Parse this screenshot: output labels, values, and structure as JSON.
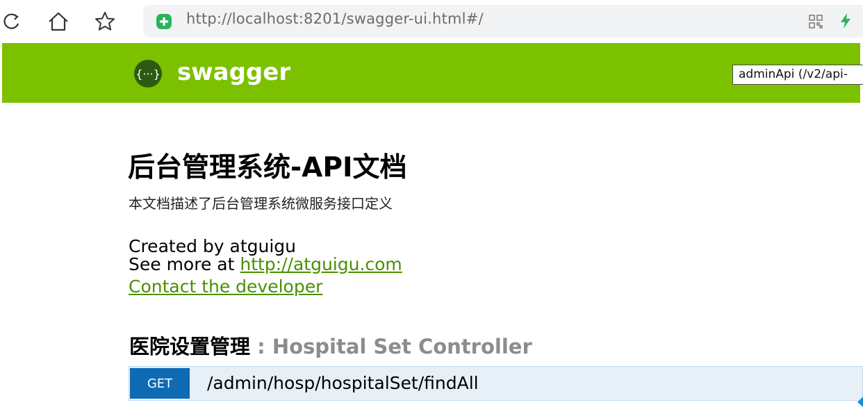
{
  "browser": {
    "url": "http://localhost:8201/swagger-ui.html#/",
    "icons": [
      "refresh-icon",
      "home-icon",
      "star-icon",
      "shield-icon",
      "qr-code-icon",
      "bolt-icon"
    ]
  },
  "topbar": {
    "logo_text": "swagger",
    "spec_select_value": "adminApi (/v2/api-"
  },
  "info": {
    "title": "后台管理系统-API文档",
    "description": "本文档描述了后台管理系统微服务接口定义",
    "created_by": "Created by atguigu",
    "see_more_prefix": "See more at ",
    "see_more_link": "http://atguigu.com",
    "contact_link": "Contact the developer"
  },
  "controller": {
    "name_cn": "医院设置管理",
    "separator": " : ",
    "name_en": "Hospital Set Controller",
    "operations": [
      {
        "method": "GET",
        "path": "/admin/hosp/hospitalSet/findAll"
      }
    ]
  },
  "colors": {
    "topbar": "#7cc100",
    "link": "#4a8f00",
    "get_method": "#0f6ab4",
    "get_bg": "#e7f0f7"
  }
}
